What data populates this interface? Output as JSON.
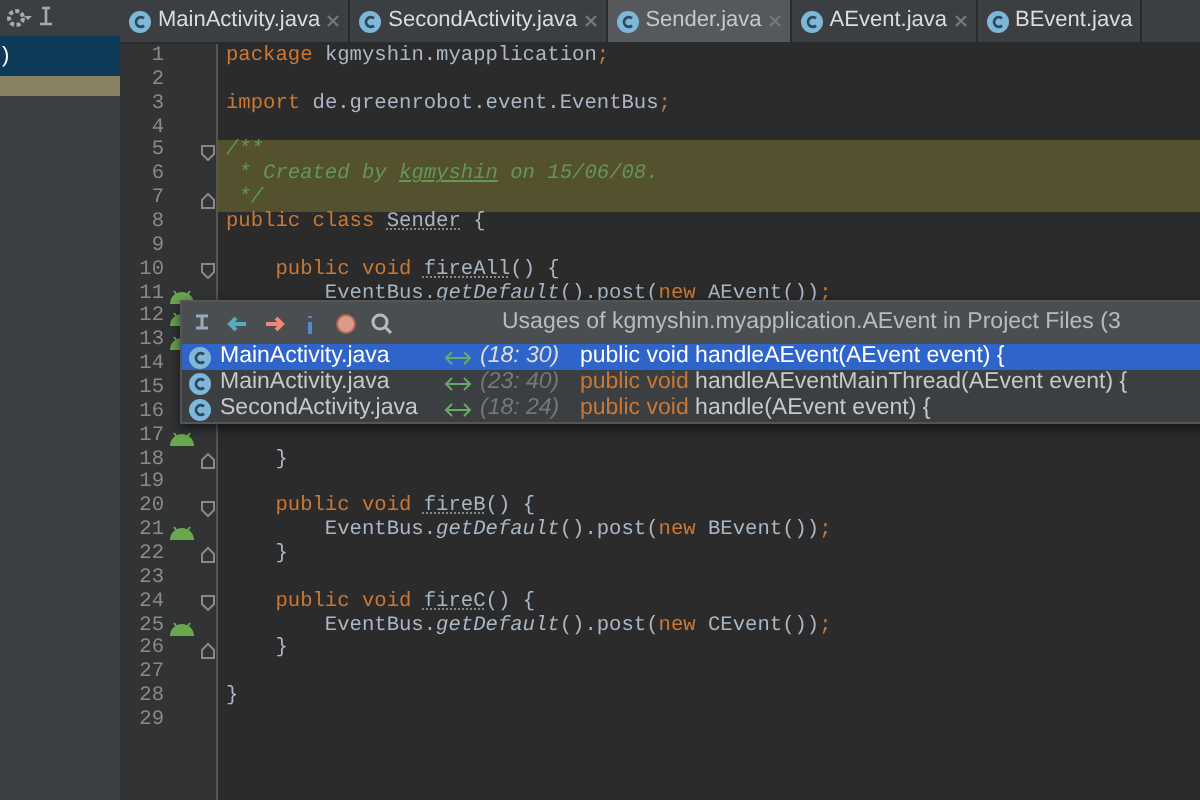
{
  "left_panel": {
    "rows": [
      {
        "label": ")",
        "selected": true
      },
      {
        "highlighted": true
      }
    ]
  },
  "tabs": [
    {
      "label": "MainActivity.java",
      "selected": false
    },
    {
      "label": "SecondActivity.java",
      "selected": false
    },
    {
      "label": "Sender.java",
      "selected": true
    },
    {
      "label": "AEvent.java",
      "selected": false
    },
    {
      "label": "BEvent.java",
      "selected": false
    }
  ],
  "code_lines": [
    {
      "number": "1",
      "tokens": [
        {
          "kind": "kw",
          "s": "package "
        },
        {
          "kind": "plain",
          "s": "kgmyshin.myapplication"
        },
        {
          "kind": "kw",
          "s": ";"
        }
      ]
    },
    {
      "number": "2"
    },
    {
      "number": "3",
      "tokens": [
        {
          "kind": "kw",
          "s": "import "
        },
        {
          "kind": "plain",
          "s": "de.greenrobot.event.EventBus"
        },
        {
          "kind": "kw",
          "s": ";"
        }
      ]
    },
    {
      "number": "4"
    },
    {
      "number": "5",
      "highlighted": true,
      "fold_start": true,
      "tokens": [
        {
          "kind": "comment",
          "s": "/**"
        }
      ]
    },
    {
      "number": "6",
      "highlighted": true,
      "tokens": [
        {
          "kind": "comment",
          "s": " * Created by "
        },
        {
          "kind": "commentlink",
          "s": "kgmyshin"
        },
        {
          "kind": "comment",
          "s": " on 15/06/08."
        }
      ]
    },
    {
      "number": "7",
      "highlighted": true,
      "fold_end": true,
      "tokens": [
        {
          "kind": "comment",
          "s": " */"
        }
      ]
    },
    {
      "number": "8",
      "tokens": [
        {
          "kind": "kw",
          "s": "public class "
        },
        {
          "kind": "decl",
          "s": "Sender"
        },
        {
          "kind": "plain",
          "s": " {"
        }
      ]
    },
    {
      "number": "9"
    },
    {
      "number": "10",
      "fold_start": true,
      "tokens": [
        {
          "kind": "kw",
          "s": "    public void "
        },
        {
          "kind": "decl",
          "s": "fireAll"
        },
        {
          "kind": "plain",
          "s": "() {"
        }
      ]
    },
    {
      "number": "11",
      "android_marker": true,
      "tokens": [
        {
          "kind": "plain",
          "s": "        EventBus."
        },
        {
          "kind": "italic",
          "s": "getDefault"
        },
        {
          "kind": "plain",
          "s": "().post("
        },
        {
          "kind": "kw",
          "s": "new "
        },
        {
          "kind": "plain",
          "s": "AEvent())"
        },
        {
          "kind": "kw",
          "s": ";"
        }
      ]
    },
    {
      "number": "12",
      "android_marker": true
    },
    {
      "number": "13",
      "android_marker": true
    },
    {
      "number": "14"
    },
    {
      "number": "15"
    },
    {
      "number": "16"
    },
    {
      "number": "17",
      "android_marker": true
    },
    {
      "number": "18",
      "fold_end": true,
      "tokens": [
        {
          "kind": "plain",
          "s": "    }"
        }
      ]
    },
    {
      "number": "19"
    },
    {
      "number": "20",
      "fold_start": true,
      "tokens": [
        {
          "kind": "kw",
          "s": "    public void "
        },
        {
          "kind": "decl",
          "s": "fireB"
        },
        {
          "kind": "plain",
          "s": "() {"
        }
      ]
    },
    {
      "number": "21",
      "android_marker": true,
      "tokens": [
        {
          "kind": "plain",
          "s": "        EventBus."
        },
        {
          "kind": "italic",
          "s": "getDefault"
        },
        {
          "kind": "plain",
          "s": "().post("
        },
        {
          "kind": "kw",
          "s": "new "
        },
        {
          "kind": "plain",
          "s": "BEvent())"
        },
        {
          "kind": "kw",
          "s": ";"
        }
      ]
    },
    {
      "number": "22",
      "fold_end": true,
      "tokens": [
        {
          "kind": "plain",
          "s": "    }"
        }
      ]
    },
    {
      "number": "23"
    },
    {
      "number": "24",
      "fold_start": true,
      "tokens": [
        {
          "kind": "kw",
          "s": "    public void "
        },
        {
          "kind": "decl",
          "s": "fireC"
        },
        {
          "kind": "plain",
          "s": "() {"
        }
      ]
    },
    {
      "number": "25",
      "android_marker": true,
      "tokens": [
        {
          "kind": "plain",
          "s": "        EventBus."
        },
        {
          "kind": "italic",
          "s": "getDefault"
        },
        {
          "kind": "plain",
          "s": "().post("
        },
        {
          "kind": "kw",
          "s": "new "
        },
        {
          "kind": "plain",
          "s": "CEvent())"
        },
        {
          "kind": "kw",
          "s": ";"
        }
      ]
    },
    {
      "number": "26",
      "fold_end": true,
      "tokens": [
        {
          "kind": "plain",
          "s": "    }"
        }
      ]
    },
    {
      "number": "27"
    },
    {
      "number": "28",
      "tokens": [
        {
          "kind": "plain",
          "s": "}"
        }
      ]
    },
    {
      "number": "29"
    }
  ],
  "usages_popup": {
    "title": "Usages of kgmyshin.myapplication.AEvent in Project Files (3",
    "rows": [
      {
        "file": "MainActivity.java",
        "position": "(18: 30)",
        "selected": true,
        "code": [
          {
            "kind": "kw",
            "s": "public void "
          },
          {
            "kind": "plain",
            "s": "handleAEvent(AEvent event) {"
          }
        ]
      },
      {
        "file": "MainActivity.java",
        "position": "(23: 40)",
        "selected": false,
        "code": [
          {
            "kind": "kw",
            "s": "public void "
          },
          {
            "kind": "plain",
            "s": "handleAEventMainThread(AEvent event) {"
          }
        ]
      },
      {
        "file": "SecondActivity.java",
        "position": "(18: 24)",
        "selected": false,
        "code": [
          {
            "kind": "kw",
            "s": "public void "
          },
          {
            "kind": "plain",
            "s": "handle(AEvent event) {"
          }
        ]
      }
    ]
  }
}
